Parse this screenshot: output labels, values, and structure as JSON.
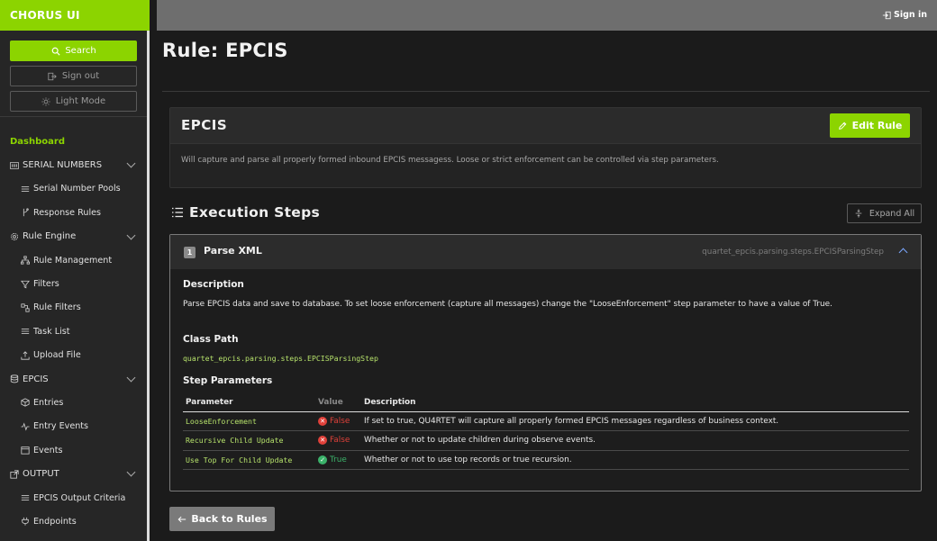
{
  "sidebar": {
    "brand": "CHORUS UI",
    "search_label": "Search",
    "signout_label": "Sign out",
    "lightmode_label": "Light Mode",
    "dashboard_label": "Dashboard",
    "items": [
      {
        "label": "SERIAL NUMBERS",
        "icon": "barcode-icon",
        "level": "top",
        "chevron": true
      },
      {
        "label": "Serial Number Pools",
        "icon": "list-icon",
        "level": "sub"
      },
      {
        "label": "Response Rules",
        "icon": "branch-icon",
        "level": "sub"
      },
      {
        "label": "Rule Engine",
        "icon": "gear-icon",
        "level": "top",
        "chevron": true
      },
      {
        "label": "Rule Management",
        "icon": "sitemap-icon",
        "level": "sub"
      },
      {
        "label": "Filters",
        "icon": "filter-icon",
        "level": "sub"
      },
      {
        "label": "Rule Filters",
        "icon": "rule-filter-icon",
        "level": "sub"
      },
      {
        "label": "Task List",
        "icon": "list-icon",
        "level": "sub"
      },
      {
        "label": "Upload File",
        "icon": "upload-icon",
        "level": "sub"
      },
      {
        "label": "EPCIS",
        "icon": "database-icon",
        "level": "top",
        "chevron": true
      },
      {
        "label": "Entries",
        "icon": "box-icon",
        "level": "sub"
      },
      {
        "label": "Entry Events",
        "icon": "activity-icon",
        "level": "sub"
      },
      {
        "label": "Events",
        "icon": "calendar-icon",
        "level": "sub"
      },
      {
        "label": "OUTPUT",
        "icon": "export-icon",
        "level": "top",
        "chevron": true
      },
      {
        "label": "EPCIS Output Criteria",
        "icon": "list-icon",
        "level": "sub"
      },
      {
        "label": "Endpoints",
        "icon": "plug-icon",
        "level": "sub"
      }
    ]
  },
  "topbar": {
    "signin_label": "Sign in"
  },
  "page": {
    "title": "Rule: EPCIS"
  },
  "rule": {
    "name": "EPCIS",
    "edit_label": "Edit Rule",
    "description": "Will capture and parse all properly formed inbound EPCIS messagess. Loose or strict enforcement can be controlled via step parameters."
  },
  "execution": {
    "title": "Execution Steps",
    "expand_label": "Expand All",
    "steps": [
      {
        "number": "1",
        "name": "Parse XML",
        "class_path": "quartet_epcis.parsing.steps.EPCISParsingStep",
        "description_heading": "Description",
        "description": "Parse EPCIS data and save to database. To set loose enforcement (capture all messages) change the \"LooseEnforcement\" step parameter to have a value of True.",
        "class_path_heading": "Class Path",
        "params_heading": "Step Parameters",
        "param_columns": [
          "Parameter",
          "Value",
          "Description"
        ],
        "params": [
          {
            "name": "LooseEnforcement",
            "value": "False",
            "status": "false",
            "description": "If set to true, QU4RTET will capture all properly formed EPCIS messages regardless of business context."
          },
          {
            "name": "Recursive Child Update",
            "value": "False",
            "status": "false",
            "description": "Whether or not to update children during observe events."
          },
          {
            "name": "Use Top For Child Update",
            "value": "True",
            "status": "true",
            "description": "Whether or not to use top records or true recursion."
          }
        ]
      }
    ]
  },
  "footer": {
    "back_label": "Back to Rules"
  },
  "colors": {
    "accent": "#8cd400",
    "false": "#e0413a",
    "true": "#3bb26a"
  }
}
